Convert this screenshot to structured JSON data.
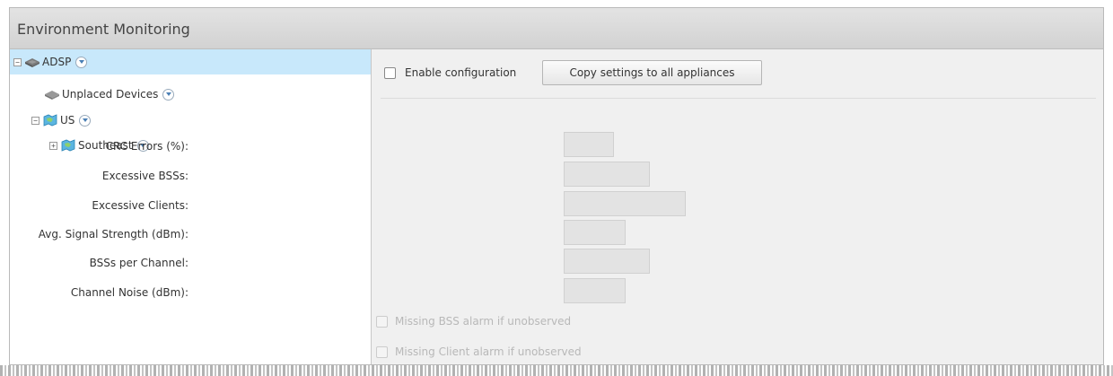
{
  "panel": {
    "title": "Environment Monitoring"
  },
  "tree": {
    "root": {
      "label": "ADSP",
      "icon": "network-device-icon",
      "expander": "−"
    },
    "unplaced": {
      "label": "Unplaced Devices",
      "icon": "device-gray-icon"
    },
    "country": {
      "label": "US",
      "icon": "map-region-icon",
      "expander": "−"
    },
    "region": {
      "label": "Southeast",
      "icon": "map-region-icon",
      "expander": "+"
    }
  },
  "toolbar": {
    "enable_label": "Enable configuration",
    "copy_label": "Copy settings to all appliances"
  },
  "fields": {
    "crc": {
      "label": "CRC Errors (%):",
      "value": ""
    },
    "bss": {
      "label": "Excessive BSSs:",
      "value": ""
    },
    "clients": {
      "label": "Excessive Clients:",
      "value": ""
    },
    "signal": {
      "label": "Avg. Signal Strength (dBm):",
      "value": ""
    },
    "bss_channel": {
      "label": "BSSs per Channel:",
      "value": ""
    },
    "noise": {
      "label": "Channel Noise (dBm):",
      "value": ""
    }
  },
  "alarms": {
    "missing_bss": "Missing BSS alarm if unobserved",
    "missing_client": "Missing Client alarm if unobserved"
  },
  "colors": {
    "selected_row": "#c8e8fb",
    "title_bar": "#d2d2d2",
    "content_bg": "#f0f0f0"
  }
}
